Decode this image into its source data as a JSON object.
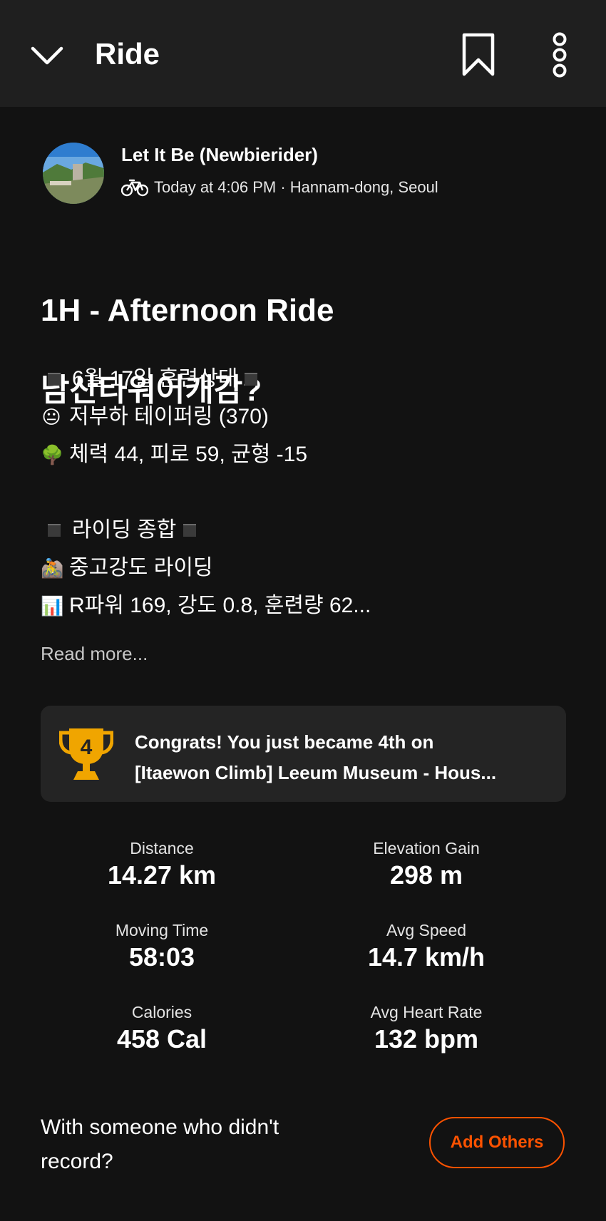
{
  "header": {
    "title": "Ride",
    "back_icon": "chevron-down-icon",
    "bookmark_icon": "bookmark-icon",
    "more_icon": "more-vertical-icon"
  },
  "athlete": {
    "name": "Let It Be (Newbierider)",
    "sport_icon": "bike-icon",
    "meta": "Today at 4:06 PM · Hannam-dong, Seoul"
  },
  "activity": {
    "title_line1": "1H - Afternoon Ride",
    "title_line2": "남산타워어캐감?",
    "description": [
      {
        "prefix": "square",
        "text": "6월 17일 훈련상태",
        "suffix": "square"
      },
      {
        "prefix": "😐",
        "text": "저부하 테이퍼링 (370)"
      },
      {
        "prefix": "🌳",
        "text": "체력 44, 피로 59, 균형 -15"
      },
      {
        "prefix": "square",
        "text": "라이딩 종합",
        "suffix": "square"
      },
      {
        "prefix": "🚵",
        "text": "중고강도 라이딩"
      },
      {
        "prefix": "📊",
        "text": "R파워 169, 강도 0.8, 훈련량 62..."
      }
    ],
    "read_more": "Read more..."
  },
  "achievement": {
    "icon": "trophy-icon",
    "rank": "4",
    "line1": "Congrats! You just became 4th on",
    "line2": "[Itaewon Climb] Leeum Museum - Hous..."
  },
  "stats": [
    {
      "label": "Distance",
      "value": "14.27 km"
    },
    {
      "label": "Elevation Gain",
      "value": "298 m"
    },
    {
      "label": "Moving Time",
      "value": "58:03"
    },
    {
      "label": "Avg Speed",
      "value": "14.7 km/h"
    },
    {
      "label": "Calories",
      "value": "458 Cal"
    },
    {
      "label": "Avg Heart Rate",
      "value": "132 bpm"
    }
  ],
  "footer": {
    "question": "With someone who didn't record?",
    "add_button": "Add Others"
  },
  "colors": {
    "background": "#121212",
    "header_bg": "#1f1f1f",
    "card_bg": "#242424",
    "accent": "#fc5200",
    "trophy": "#f0a500"
  }
}
